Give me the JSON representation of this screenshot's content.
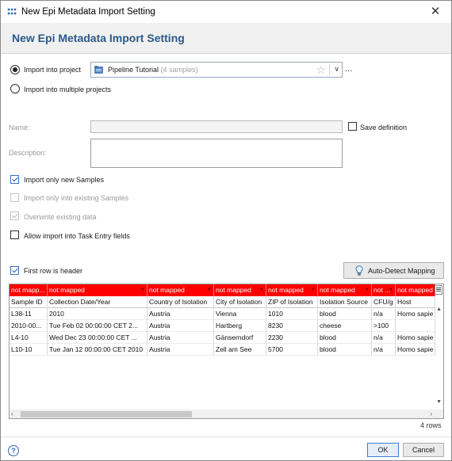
{
  "window": {
    "title": "New Epi Metadata Import Setting",
    "close_glyph": "✕"
  },
  "header": {
    "title": "New Epi Metadata Import Setting"
  },
  "import_target": {
    "into_project_label": "Import into project",
    "into_project_selected": true,
    "project_name": "Pipeline Tutorial",
    "project_count": "(4 samples)",
    "more_label": "...",
    "into_multiple_label": "Import into multiple projects",
    "into_multiple_selected": false
  },
  "form": {
    "name_label": "Name:",
    "name_value": "",
    "save_definition_label": "Save definition",
    "save_definition_checked": false,
    "description_label": "Description:",
    "description_value": ""
  },
  "options": [
    {
      "label": "Import only new Samples",
      "checked": true,
      "enabled": true
    },
    {
      "label": "Import only into existing Samples",
      "checked": false,
      "enabled": false
    },
    {
      "label": "Overwrite existing data",
      "checked": true,
      "enabled": false
    },
    {
      "label": "Allow import into Task Entry fields",
      "checked": false,
      "enabled": true
    }
  ],
  "first_row_header": {
    "label": "First row is header",
    "checked": true
  },
  "auto_detect": {
    "label": "Auto-Detect Mapping"
  },
  "table": {
    "mapping": [
      "not mapp...",
      "not mapped",
      "not mapped",
      "not mapped",
      "not mapped",
      "not mapped",
      "not ...",
      "not mapped"
    ],
    "columns": [
      "Sample ID",
      "Collection Date/Year",
      "Country of Isolation",
      "City of Isolation",
      "ZIP of Isolation",
      "Isolation Source",
      "CFU/g",
      "Host"
    ],
    "rows": [
      [
        "L38-11",
        "2010",
        "Austria",
        "Vienna",
        "1010",
        "blood",
        "n/a",
        "Homo sapie"
      ],
      [
        "2010-00...",
        "Tue Feb 02 00:00:00 CET 2...",
        "Austria",
        "Hartberg",
        "8230",
        "cheese",
        ">100",
        ""
      ],
      [
        "L4-10",
        "Wed Dec 23 00:00:00 CET ...",
        "Austria",
        "Gänserndorf",
        "2230",
        "blood",
        "n/a",
        "Homo sapie"
      ],
      [
        "L10-10",
        "Tue Jan 12 00:00:00 CET 2010",
        "Austria",
        "Zell am See",
        "5700",
        "blood",
        "n/a",
        "Homo sapie"
      ]
    ],
    "row_count_label": "4 rows"
  },
  "buttons": {
    "ok": "OK",
    "cancel": "Cancel"
  },
  "help": {
    "glyph": "?"
  },
  "colors": {
    "accent": "#2a5a8a",
    "mapping_bg": "#ff0000"
  }
}
